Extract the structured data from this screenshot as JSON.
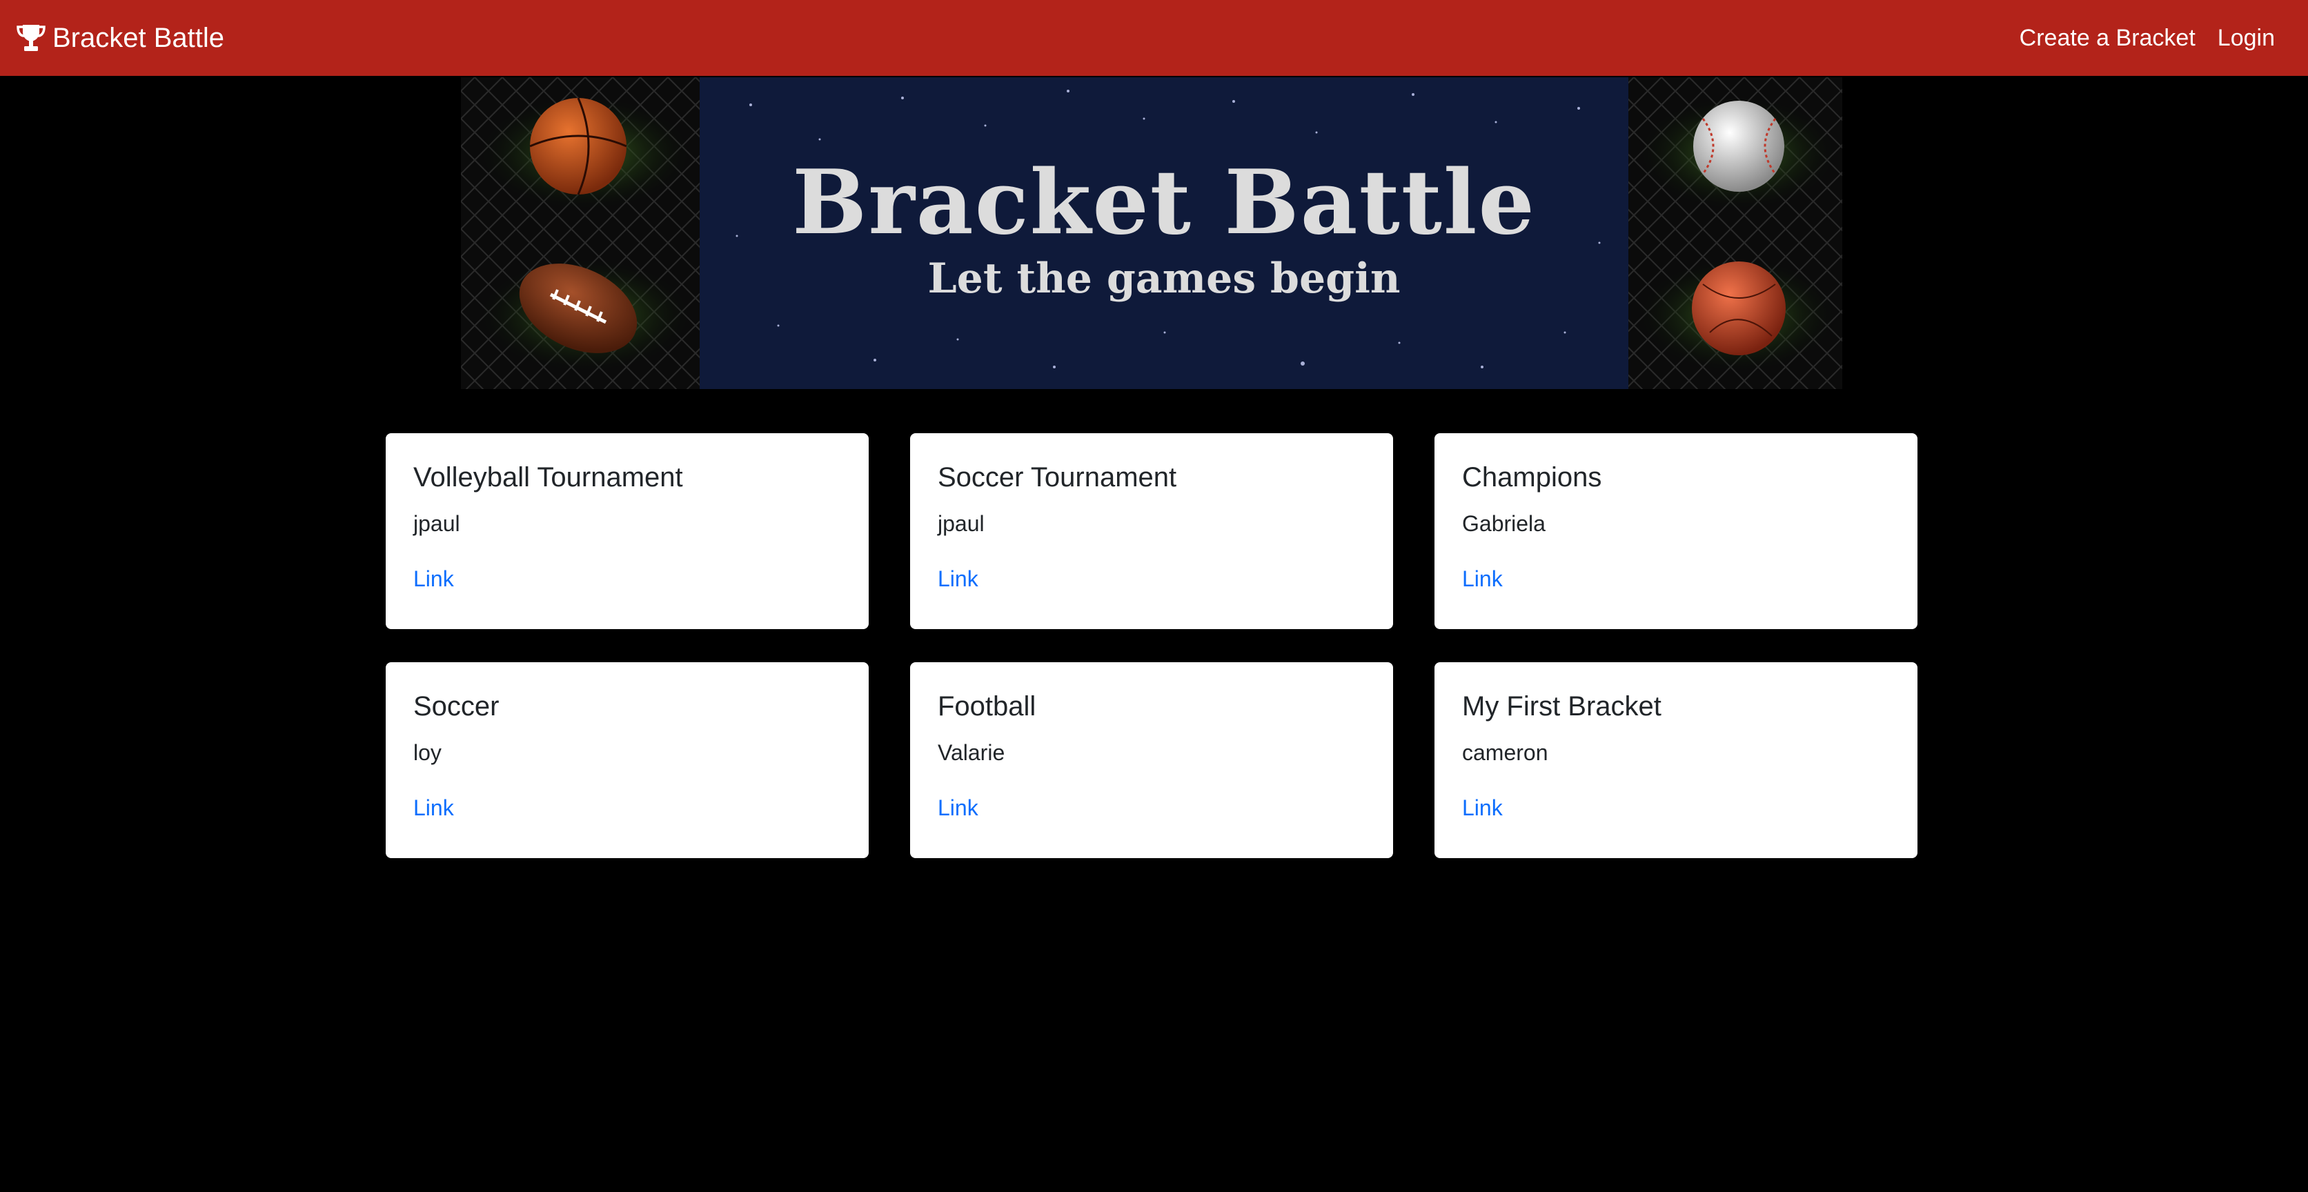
{
  "navbar": {
    "brand_label": "Bracket Battle",
    "brand_icon": "trophy-icon",
    "links": [
      {
        "label": "Create a Bracket"
      },
      {
        "label": "Login"
      }
    ],
    "background_color": "#b3231a"
  },
  "banner": {
    "title": "Bracket Battle",
    "subtitle": "Let the games begin"
  },
  "brackets": [
    {
      "title": "Volleyball Tournament",
      "author": "jpaul",
      "link_label": "Link"
    },
    {
      "title": "Soccer Tournament",
      "author": "jpaul",
      "link_label": "Link"
    },
    {
      "title": "Champions",
      "author": "Gabriela",
      "link_label": "Link"
    },
    {
      "title": "Soccer",
      "author": "loy",
      "link_label": "Link"
    },
    {
      "title": "Football",
      "author": "Valarie",
      "link_label": "Link"
    },
    {
      "title": "My First Bracket",
      "author": "cameron",
      "link_label": "Link"
    }
  ],
  "colors": {
    "page_background": "#000000",
    "card_background": "#ffffff",
    "link_color": "#0d6efd"
  }
}
